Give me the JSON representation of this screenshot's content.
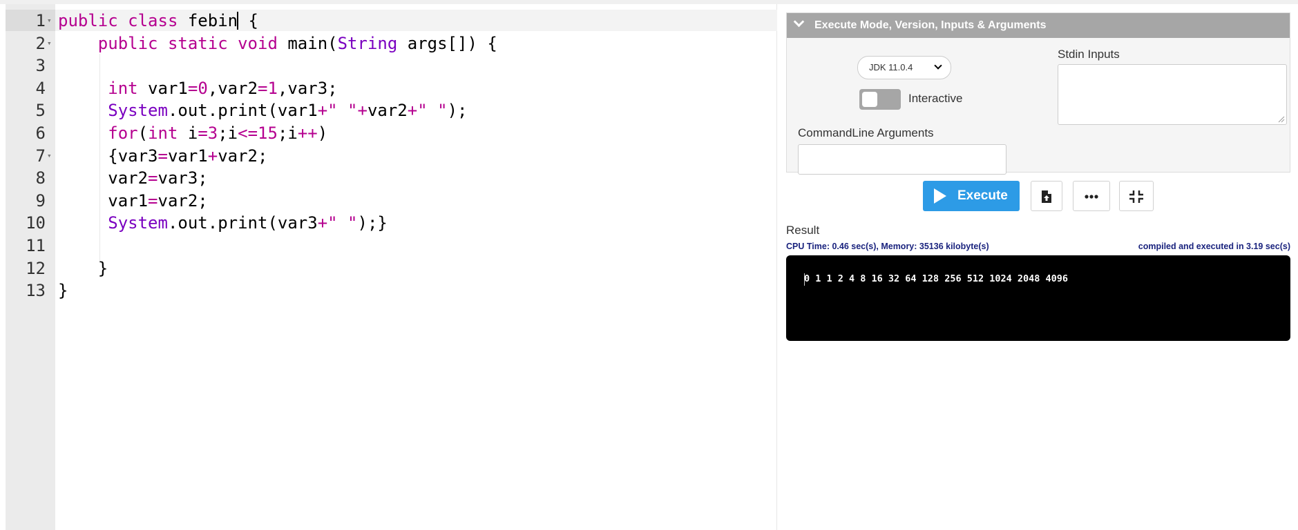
{
  "editor": {
    "line_numbers": [
      "1",
      "2",
      "3",
      "4",
      "5",
      "6",
      "7",
      "8",
      "9",
      "10",
      "11",
      "12",
      "13"
    ],
    "fold_markers": {
      "1": "▾",
      "2": "▾",
      "7": "▾"
    },
    "lines": [
      "public class febin {",
      "    public static void main(String args[]) {",
      "",
      "     int var1=0,var2=1,var3;",
      "     System.out.print(var1+\" \"+var2+\" \");",
      "     for(int i=3;i<=15;i++)",
      "     {var3=var1+var2;",
      "     var2=var3;",
      "     var1=var2;",
      "     System.out.print(var3+\" \");}",
      "",
      "    }",
      "}"
    ]
  },
  "settings": {
    "header": "Execute Mode, Version, Inputs & Arguments",
    "jdk_version": "JDK 11.0.4",
    "interactive_label": "Interactive",
    "interactive_on": false,
    "commandline_label": "CommandLine Arguments",
    "commandline_value": "",
    "stdin_label": "Stdin Inputs",
    "stdin_value": ""
  },
  "actions": {
    "execute_label": "Execute",
    "icons": [
      "file-upload-icon",
      "more-icon",
      "collapse-icon"
    ]
  },
  "result": {
    "label": "Result",
    "cpu_memory": "CPU Time: 0.46 sec(s), Memory: 35136 kilobyte(s)",
    "compiled": "compiled and executed in 3.19 sec(s)",
    "output": "0 1 1 2 4 8 16 32 64 128 256 512 1024 2048 4096"
  },
  "colors": {
    "execute_button": "#2d9be6",
    "settings_header": "#a6a6a6",
    "keyword": "#b5008f",
    "type": "#7a00c0",
    "output_bg": "#000000"
  }
}
